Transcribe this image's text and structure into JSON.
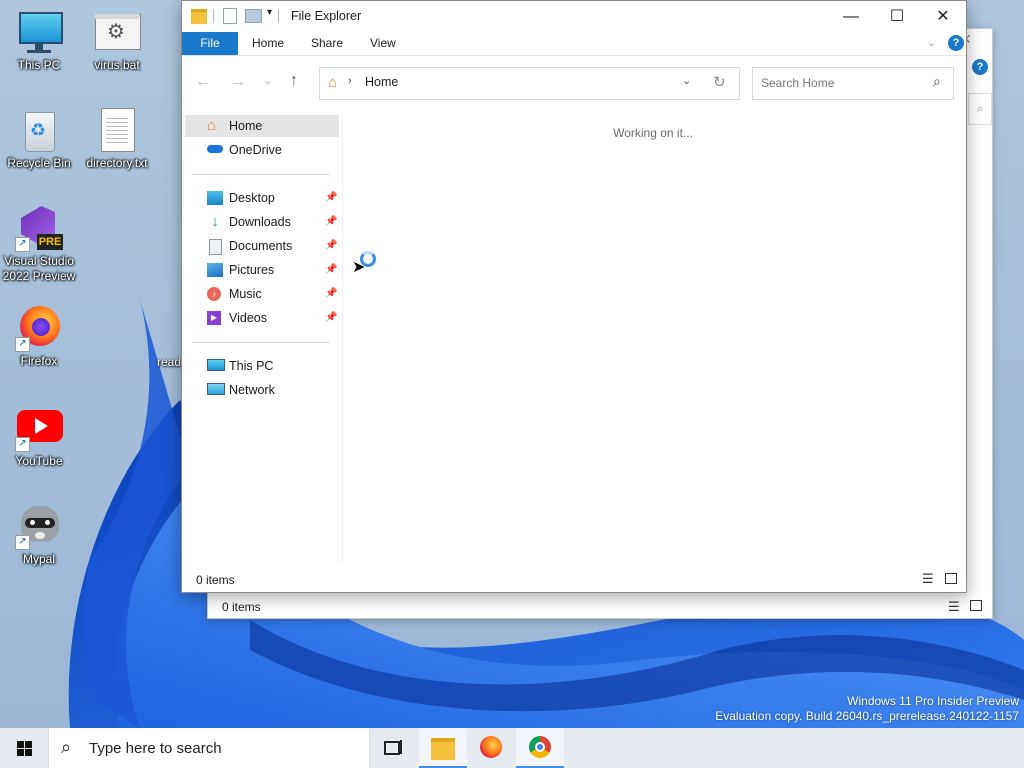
{
  "desktop": {
    "icons": [
      {
        "label": "This PC",
        "icon": "this-pc-icon"
      },
      {
        "label": "virus.bat",
        "icon": "batch-file-icon"
      },
      {
        "label": "Recycle Bin",
        "icon": "recycle-bin-icon"
      },
      {
        "label": "directory.txt",
        "icon": "text-file-icon"
      },
      {
        "label": "Visual Studio 2022 Preview",
        "label_line1": "Visual Studio",
        "label_line2": "2022 Preview",
        "badge": "PRE",
        "icon": "visual-studio-icon"
      },
      {
        "label": "Firefox",
        "icon": "firefox-icon"
      },
      {
        "label": "YouTube",
        "icon": "youtube-icon"
      },
      {
        "label": "Mypal",
        "icon": "mypal-raccoon-icon"
      }
    ],
    "partial_label": "read",
    "watermark_line1": "Windows 11 Pro Insider Preview",
    "watermark_line2": "Evaluation copy. Build 26040.rs_prerelease.240122-1157"
  },
  "back_window": {
    "status_text": "0 items"
  },
  "explorer": {
    "title": "File Explorer",
    "ribbon_tabs": [
      "File",
      "Home",
      "Share",
      "View"
    ],
    "address": {
      "location": "Home"
    },
    "search_placeholder": "Search Home",
    "nav": {
      "home": "Home",
      "onedrive": "OneDrive",
      "quick": [
        {
          "label": "Desktop",
          "icon": "desktop-folder-icon"
        },
        {
          "label": "Downloads",
          "icon": "downloads-icon"
        },
        {
          "label": "Documents",
          "icon": "documents-icon"
        },
        {
          "label": "Pictures",
          "icon": "pictures-icon"
        },
        {
          "label": "Music",
          "icon": "music-icon"
        },
        {
          "label": "Videos",
          "icon": "videos-icon"
        }
      ],
      "this_pc": "This PC",
      "network": "Network"
    },
    "content_message": "Working on it...",
    "status_text": "0 items"
  },
  "taskbar": {
    "search_placeholder": "Type here to search",
    "apps": [
      "task-view-icon",
      "file-explorer-icon",
      "firefox-icon",
      "chrome-icon"
    ]
  },
  "colors": {
    "accent": "#1979ca",
    "selection": "#e5e5e5",
    "taskbar": "#e6ebf2"
  }
}
